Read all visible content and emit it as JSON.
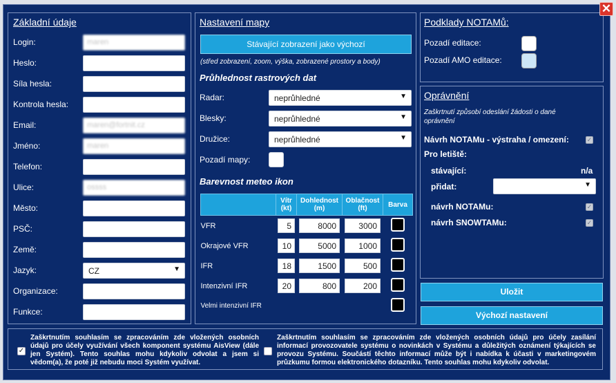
{
  "personal": {
    "title": "Základní údaje",
    "fields": [
      {
        "label": "Login:",
        "value": "maren",
        "type": "text"
      },
      {
        "label": "Heslo:",
        "value": "",
        "type": "text"
      },
      {
        "label": "Síla hesla:",
        "value": "",
        "type": "text"
      },
      {
        "label": "Kontrola hesla:",
        "value": "",
        "type": "text"
      },
      {
        "label": "Email:",
        "value": "maren@fortnit.cz",
        "type": "text"
      },
      {
        "label": "Jméno:",
        "value": "maren",
        "type": "text"
      },
      {
        "label": "Telefon:",
        "value": "",
        "type": "text"
      },
      {
        "label": "Ulice:",
        "value": "ossss",
        "type": "text"
      },
      {
        "label": "Město:",
        "value": "",
        "type": "text"
      },
      {
        "label": "PSČ:",
        "value": "",
        "type": "text"
      },
      {
        "label": "Země:",
        "value": "",
        "type": "text"
      },
      {
        "label": "Jazyk:",
        "value": "CZ",
        "type": "select"
      },
      {
        "label": "Organizace:",
        "value": "",
        "type": "text"
      },
      {
        "label": "Funkce:",
        "value": "",
        "type": "text"
      }
    ]
  },
  "map": {
    "title": "Nastavení mapy",
    "set_default_button": "Stávající zobrazení jako výchozí",
    "note": "(střed zobrazení, zoom, výška, zobrazené prostory a body)",
    "transparency_heading": "Průhlednost rastrových dat",
    "transparency": [
      {
        "label": "Radar:",
        "value": "neprůhledné"
      },
      {
        "label": "Blesky:",
        "value": "neprůhledné"
      },
      {
        "label": "Družice:",
        "value": "neprůhledné"
      }
    ],
    "background_label": "Pozadí mapy:",
    "meteo_heading": "Barevnost meteo ikon",
    "table_headers": [
      "",
      "Vítr (kt)",
      "Dohlednost (m)",
      "Oblačnost (ft)",
      "Barva"
    ],
    "table_rows": [
      {
        "name": "VFR",
        "wind": "5",
        "visibility": "8000",
        "cloud": "3000"
      },
      {
        "name": "Okrajové VFR",
        "wind": "10",
        "visibility": "5000",
        "cloud": "1000"
      },
      {
        "name": "IFR",
        "wind": "18",
        "visibility": "1500",
        "cloud": "500"
      },
      {
        "name": "Intenzivní IFR",
        "wind": "20",
        "visibility": "800",
        "cloud": "200"
      },
      {
        "name": "Velmi intenzivní IFR",
        "wind": "",
        "visibility": "",
        "cloud": ""
      }
    ]
  },
  "notam": {
    "title": "Podklady NOTAMů:",
    "edit_bg_label": "Pozadí editace:",
    "amo_bg_label": "Pozadí AMO editace:",
    "edit_bg_color": "#ffffff",
    "amo_bg_color": "#cde6f7"
  },
  "rights": {
    "title": "Oprávnění",
    "note": "Zaškrtnutí způsobí odeslání žádosti o dané oprávnění",
    "notam_proposal_label": "Návrh NOTAMu - výstraha / omezení:",
    "airports_label": "Pro letiště:",
    "current_label": "stávající:",
    "current_value": "n/a",
    "add_label": "přidat:",
    "add_value": "",
    "notam_label": "návrh NOTAMu:",
    "snowtam_label": "návrh SNOWTAMu:"
  },
  "actions": {
    "save": "Uložit",
    "defaults": "Výchozí nastavení"
  },
  "consents": {
    "left": "Zaškrtnutím souhlasím se zpracováním zde vložených osobních údajů pro účely využívání všech komponent systému AisView (dále jen Systém). Tento souhlas mohu kdykoliv odvolat a jsem si vědom(a), že poté již nebudu moci Systém využívat.",
    "left_checked": true,
    "right": "Zaškrtnutím souhlasím se zpracováním zde vložených osobních údajů pro účely zasílání informací provozovatele systému o novinkách v Systému a důležitých oznámení týkajících se provozu Systému. Součástí těchto informací může být i nabídka k účasti v marketingovém průzkumu formou elektronického dotazníku. Tento souhlas mohu kdykoliv odvolat.",
    "right_checked": false
  },
  "colors": {
    "dialog_bg": "#0b2a6b",
    "accent": "#1ea3dc",
    "close": "#d9342b"
  }
}
